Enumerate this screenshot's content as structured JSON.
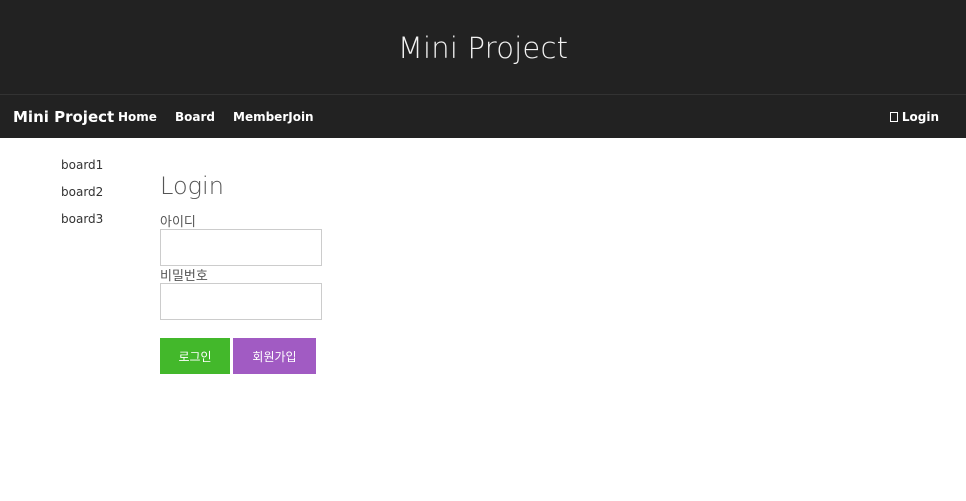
{
  "header": {
    "title": "Mini Project"
  },
  "navbar": {
    "brand": "Mini Project",
    "links": [
      "Home",
      "Board",
      "MemberJoin"
    ],
    "login": "Login",
    "login_icon": "user-icon"
  },
  "sidebar": {
    "items": [
      "board1",
      "board2",
      "board3"
    ]
  },
  "form": {
    "title": "Login",
    "id_label": "아이디",
    "id_value": "",
    "pw_label": "비밀번호",
    "pw_value": "",
    "login_button": "로그인",
    "join_button": "회원가입"
  },
  "colors": {
    "header_bg": "#222222",
    "login_button": "#43b82b",
    "join_button": "#a15bc3"
  }
}
